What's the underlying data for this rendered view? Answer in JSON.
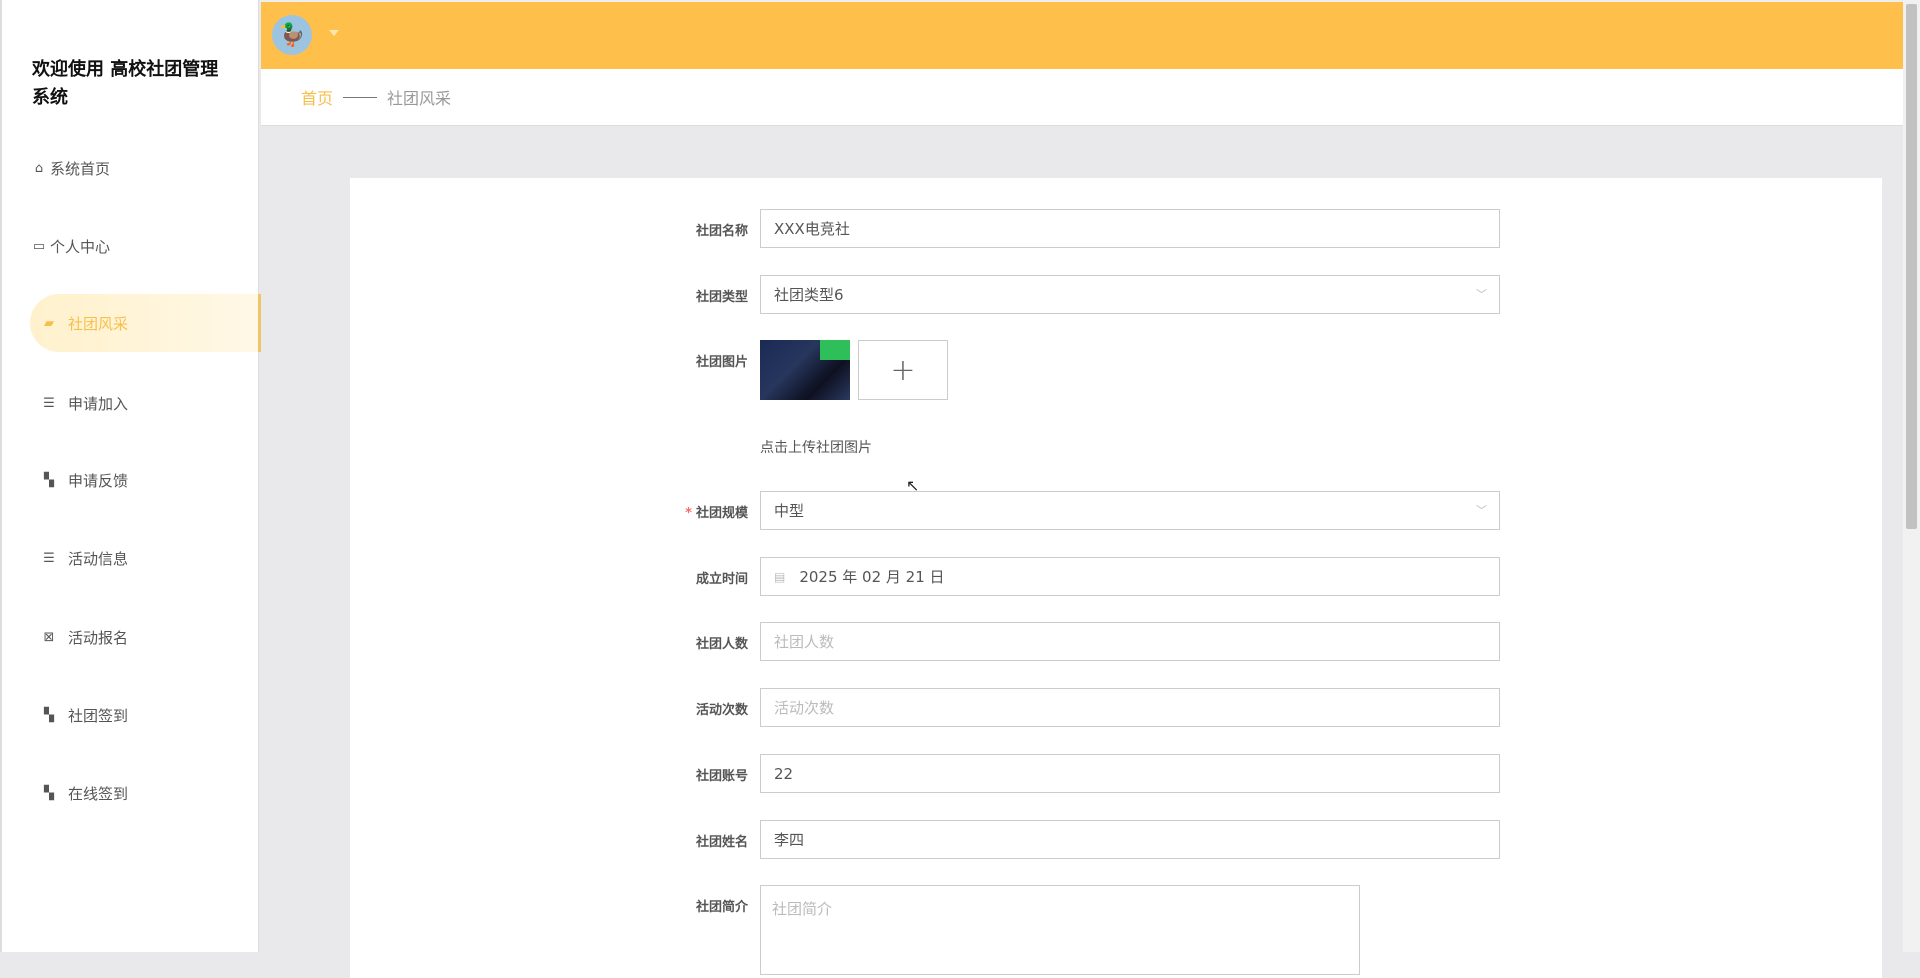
{
  "sidebar": {
    "title": "欢迎使用 高校社团管理系统",
    "items": [
      {
        "label": "系统首页",
        "icon": "home-icon"
      },
      {
        "label": "个人中心",
        "icon": "wallet-icon"
      },
      {
        "label": "社团风采",
        "icon": "ticket-icon",
        "active": true
      },
      {
        "label": "申请加入",
        "icon": "list-icon"
      },
      {
        "label": "申请反馈",
        "icon": "grid-icon"
      },
      {
        "label": "活动信息",
        "icon": "list-icon"
      },
      {
        "label": "活动报名",
        "icon": "clipboard-icon"
      },
      {
        "label": "社团签到",
        "icon": "grid-icon"
      },
      {
        "label": "在线签到",
        "icon": "grid-icon"
      }
    ]
  },
  "header": {
    "avatar_icon": "duck-avatar",
    "accent": "#fec04a"
  },
  "breadcrumb": {
    "home": "首页",
    "current": "社团风采"
  },
  "form": {
    "name": {
      "label": "社团名称",
      "value": "XXX电竞社"
    },
    "type": {
      "label": "社团类型",
      "value": "社团类型6"
    },
    "image": {
      "label": "社团图片",
      "hint": "点击上传社团图片",
      "upload": "+"
    },
    "scale": {
      "label": "社团规模",
      "value": "中型",
      "required": "*"
    },
    "founded": {
      "label": "成立时间",
      "value": "2025 年 02 月 21 日"
    },
    "members": {
      "label": "社团人数",
      "placeholder": "社团人数"
    },
    "activities": {
      "label": "活动次数",
      "placeholder": "活动次数"
    },
    "account": {
      "label": "社团账号",
      "value": "22"
    },
    "owner": {
      "label": "社团姓名",
      "value": "李四"
    },
    "intro": {
      "label": "社团简介",
      "placeholder": "社团简介"
    }
  }
}
